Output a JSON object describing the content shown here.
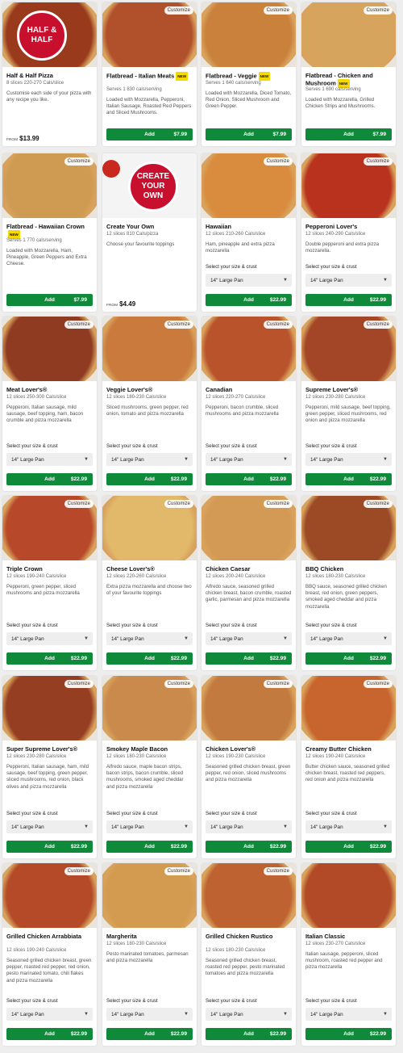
{
  "labels": {
    "customize": "Customize",
    "select_label": "Select your size & crust",
    "select_value": "14\" Large Pan",
    "add": "Add",
    "new": "NEW",
    "from": "FROM"
  },
  "products": [
    {
      "name": "Half & Half Pizza",
      "sub": "8 slices 220-270 Cals/slice",
      "desc": "Customise each side of your pizza with any recipe you like.",
      "price": "$13.99",
      "type": "from",
      "badge": "HALF & HALF",
      "img_color": "#9a3a1d"
    },
    {
      "name": "Flatbread - Italian Meats",
      "is_new": true,
      "sub": "Serves 1 830 cals/serving",
      "desc": "Loaded with Mozzarella, Pepperoni, Italian Sausage, Roasted Red Peppers and Sliced Mushrooms.",
      "price": "$7.99",
      "type": "add",
      "img_color": "#b1512b"
    },
    {
      "name": "Flatbread - Veggie",
      "is_new": true,
      "sub": "Serves 1 640 cals/serving",
      "desc": "Loaded with Mozzarella, Diced Tomato, Red Onion, Sliced Mushroom and Green Pepper.",
      "price": "$7.99",
      "type": "add",
      "img_color": "#c9813c"
    },
    {
      "name": "Flatbread - Chicken and Mushroom",
      "is_new": true,
      "sub": "Serves 1 690 cals/serving",
      "desc": "Loaded with Mozzarella, Grilled Chicken Strips and Mushrooms.",
      "price": "$7.99",
      "type": "add",
      "img_color": "#d6a45c"
    },
    {
      "name": "Flatbread - Hawaiian Crown",
      "is_new": true,
      "sub": "Serves 1 770 cals/serving",
      "desc": "Loaded with Mozzarella, Ham, Pineapple, Green Peppers and Extra Cheese.",
      "price": "$7.99",
      "type": "add",
      "img_color": "#cf9a52"
    },
    {
      "name": "Create Your Own",
      "sub": "12 slices 810 Cals/pizza",
      "desc": "Choose your favourite toppings",
      "price": "$4.49",
      "type": "from",
      "badge": "CREATE YOUR OWN",
      "img_color": "#f4f4f4"
    },
    {
      "name": "Hawaiian",
      "sub": "12 slices 210-260 Cals/slice",
      "desc": "Ham, pineapple and extra pizza mozzarella",
      "price": "$22.99",
      "type": "select",
      "img_color": "#d98b3e"
    },
    {
      "name": "Pepperoni Lover's",
      "sub": "12 slices 240-290 Cals/slice",
      "desc": "Double pepperoni and extra pizza mozzarella.",
      "price": "$22.99",
      "type": "select",
      "img_color": "#b8321d"
    },
    {
      "name": "Meat Lover's®",
      "sub": "12 slices 250-300 Cals/slice",
      "desc": "Pepperoni, Italian sausage, mild sausage, beef topping, ham, bacon crumble and pizza mozzarella",
      "price": "$22.99",
      "type": "select",
      "img_color": "#8f3b22"
    },
    {
      "name": "Veggie Lover's®",
      "sub": "12 slices 180-230 Cals/slice",
      "desc": "Sliced mushrooms, green pepper, red onion, tomato and pizza mozzarella",
      "price": "$22.99",
      "type": "select",
      "img_color": "#c97a3c"
    },
    {
      "name": "Canadian",
      "sub": "12 slices 220-270 Cals/slice",
      "desc": "Pepperoni, bacon crumble, sliced mushrooms and pizza mozzarella",
      "price": "$22.99",
      "type": "select",
      "img_color": "#b9532c"
    },
    {
      "name": "Supreme Lover's®",
      "sub": "12 slices 230-280 Cals/slice",
      "desc": "Pepperoni, mild sausage, beef topping, green pepper, sliced mushrooms, red onion and pizza mozzarella",
      "price": "$22.99",
      "type": "select",
      "img_color": "#a34627"
    },
    {
      "name": "Triple Crown",
      "sub": "12 slices 190-240 Cals/slice",
      "desc": "Pepperoni, green pepper, sliced mushrooms and pizza mozzarella",
      "price": "$22.99",
      "type": "select",
      "img_color": "#b8482a"
    },
    {
      "name": "Cheese Lover's®",
      "sub": "12 slices 220-260 Cals/slice",
      "desc": "Extra pizza mozzarella and choose two of your favourite toppings",
      "price": "$22.99",
      "type": "select",
      "img_color": "#e2b86a"
    },
    {
      "name": "Chicken Caesar",
      "sub": "12 slices 200-240 Cals/slice",
      "desc": "Alfredo sauce, seasoned grilled chicken breast, bacon crumble, roasted garlic, parmesan and pizza mozzarella",
      "price": "$22.99",
      "type": "select",
      "img_color": "#d39a55"
    },
    {
      "name": "BBQ Chicken",
      "sub": "12 slices 180-230 Cals/slice",
      "desc": "BBQ sauce, seasoned grilled chicken breast, red onion, green peppers, smoked aged cheddar and pizza mozzarella",
      "price": "$22.99",
      "type": "select",
      "img_color": "#9c4a26"
    },
    {
      "name": "Super Supreme Lover's®",
      "sub": "12 slices 230-280 Cals/slice",
      "desc": "Pepperoni, Italian sausage, ham, mild sausage, beef topping, green pepper, sliced mushrooms, red onion, black olives and pizza mozzarella",
      "price": "$22.99",
      "type": "select",
      "img_color": "#963e22"
    },
    {
      "name": "Smokey Maple Bacon",
      "sub": "12 slices 180-230 Cals/slice",
      "desc": "Alfredo sauce, maple bacon strips, bacon strips, bacon crumble, sliced mushrooms, smoked aged cheddar and pizza mozzarella",
      "price": "$22.99",
      "type": "select",
      "img_color": "#c98a4c"
    },
    {
      "name": "Chicken Lover's®",
      "sub": "12 slices 190-230 Cals/slice",
      "desc": "Seasoned grilled chicken breast, green pepper, red onion, sliced mushrooms and pizza mozzarella",
      "price": "$22.99",
      "type": "select",
      "img_color": "#c27a3e"
    },
    {
      "name": "Creamy Butter Chicken",
      "sub": "12 slices 190-240 Cals/slice",
      "desc": "Butter chicken sauce, seasoned grilled chicken breast, roasted red peppers, red onion and pizza mozzarella",
      "price": "$22.99",
      "type": "select",
      "img_color": "#c8652e"
    },
    {
      "name": "Grilled Chicken Arrabbiata",
      "sub": "12 slices 190-240 Cals/slice",
      "desc": "Seasoned grilled chicken breast, green pepper, roasted red pepper, red onion, pesto marinated tomato, chili flakes and pizza mozzarella",
      "price": "$22.99",
      "type": "select",
      "img_color": "#b44a28"
    },
    {
      "name": "Margherita",
      "sub": "12 slices 180-230 Cals/slice",
      "desc": "Pesto marinated tomatoes, parmesan and pizza mozzarella",
      "price": "$22.99",
      "type": "select",
      "img_color": "#d39b50"
    },
    {
      "name": "Grilled Chicken Rustico",
      "sub": "12 slices 180-230 Cals/slice",
      "desc": "Seasoned grilled chicken breast, roasted red pepper, pesto marinated tomatoes and pizza mozzarella",
      "price": "$22.99",
      "type": "select",
      "img_color": "#bd6230"
    },
    {
      "name": "Italian Classic",
      "sub": "12 slices 230-270 Cals/slice",
      "desc": "Italian sausage, pepperoni, sliced mushroom, roasted red pepper and pizza mozzarella",
      "price": "$22.99",
      "type": "select",
      "img_color": "#b24a28",
      "no_custom": true
    }
  ]
}
